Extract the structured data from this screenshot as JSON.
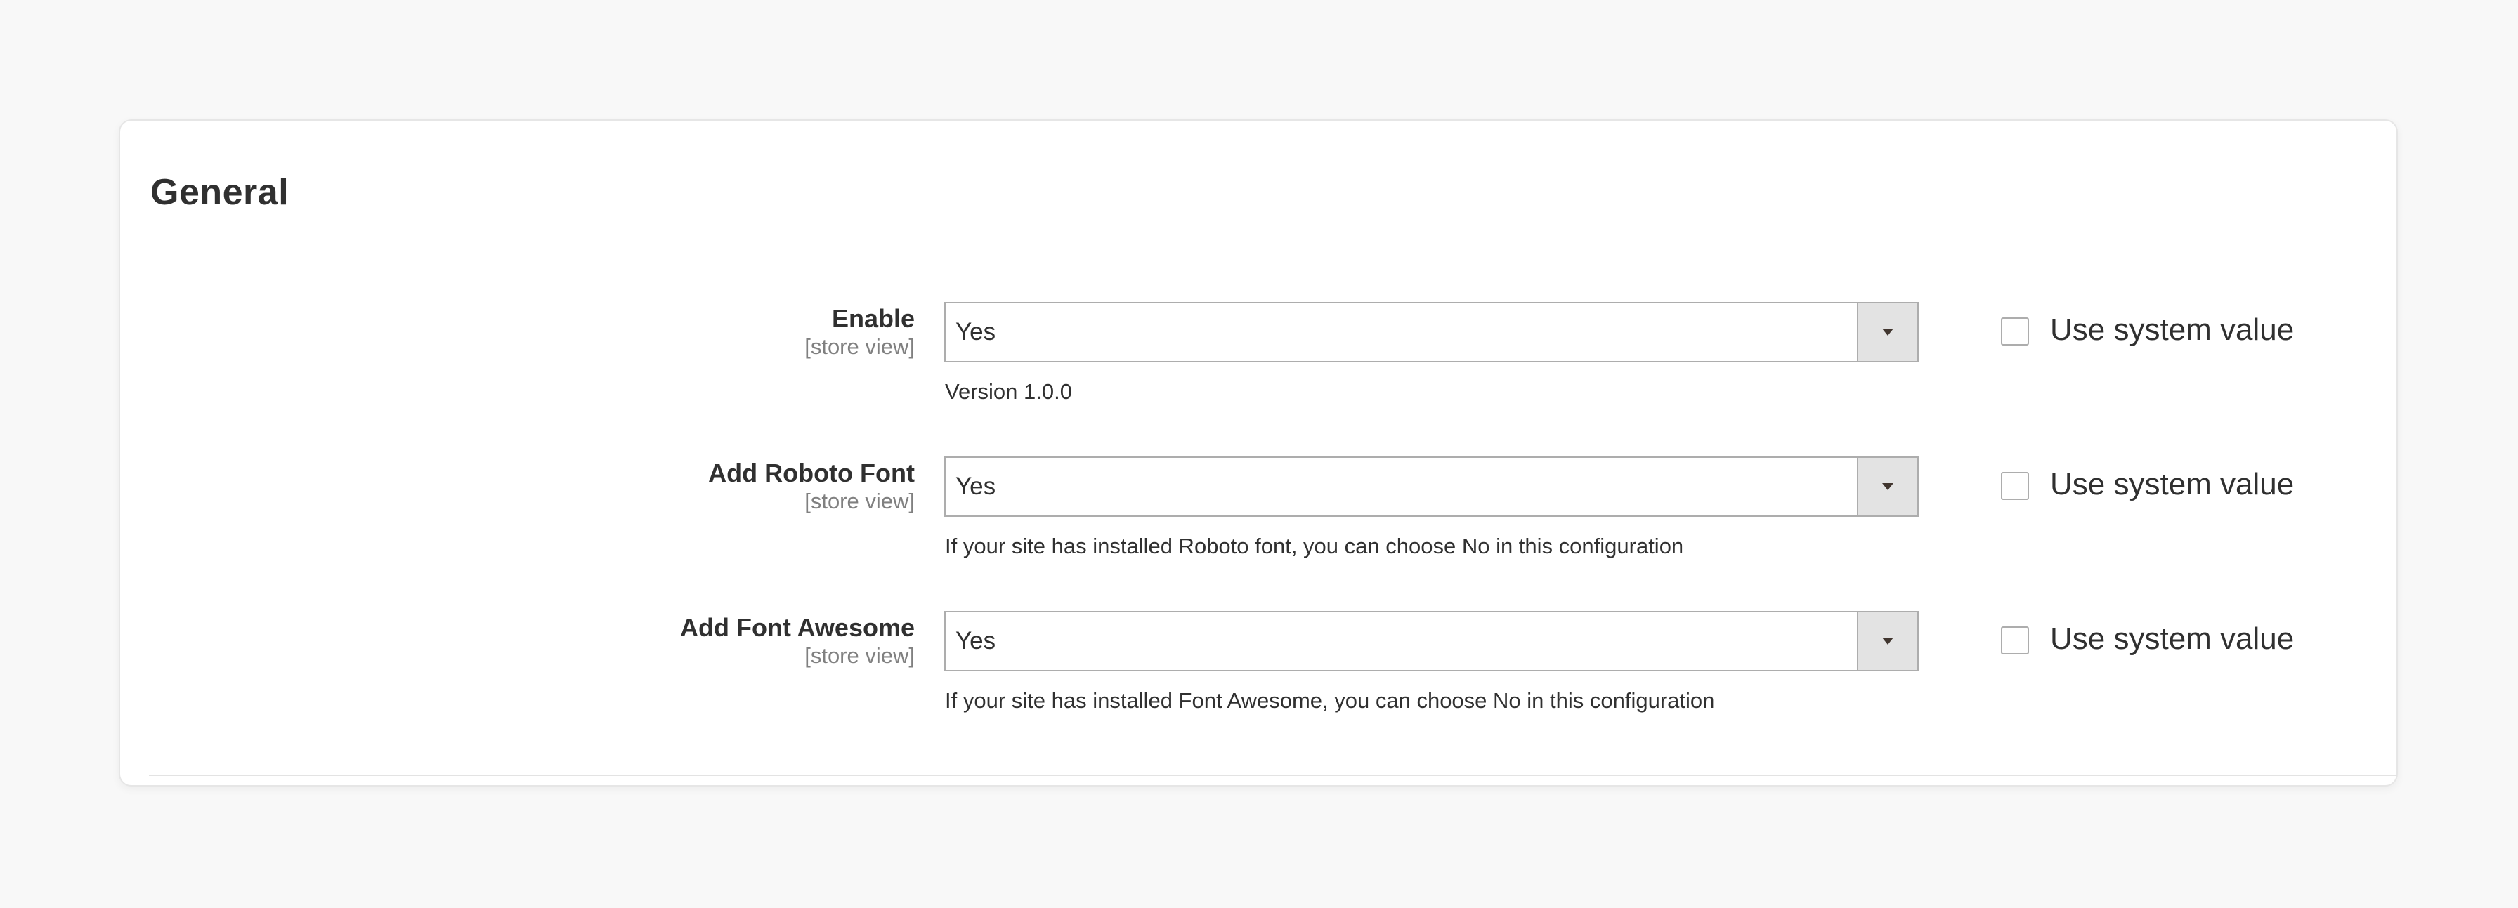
{
  "section": {
    "title": "General"
  },
  "fields": [
    {
      "label": "Enable",
      "scope": "[store view]",
      "value": "Yes",
      "note": "Version 1.0.0",
      "system_label": "Use system value"
    },
    {
      "label": "Add Roboto Font",
      "scope": "[store view]",
      "value": "Yes",
      "note": "If your site has installed Roboto font, you can choose No in this configuration",
      "system_label": "Use system value"
    },
    {
      "label": "Add Font Awesome",
      "scope": "[store view]",
      "value": "Yes",
      "note": "If your site has installed Font Awesome, you can choose No in this configuration",
      "system_label": "Use system value"
    }
  ],
  "icons": {
    "dropdown": "chevron-down-icon"
  },
  "colors": {
    "page_background": "#f8f8f8",
    "panel_background": "#ffffff",
    "border": "#adadad",
    "arrow_box": "#e3e3e3",
    "text": "#303030",
    "muted_text": "#808080"
  }
}
